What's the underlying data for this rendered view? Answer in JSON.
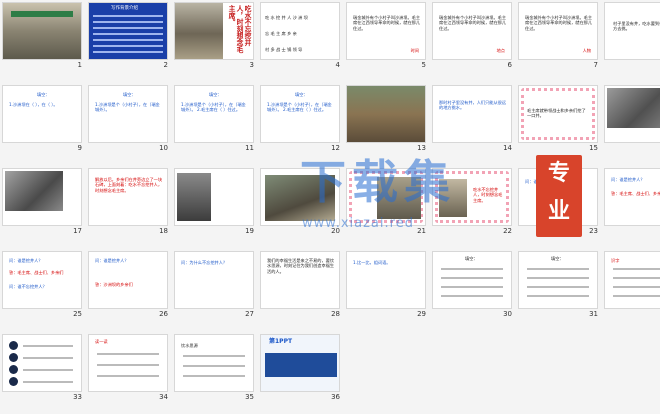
{
  "slides": [
    {
      "n": "1"
    },
    {
      "n": "2"
    },
    {
      "n": "3"
    },
    {
      "n": "4"
    },
    {
      "n": "5"
    },
    {
      "n": "6"
    },
    {
      "n": "7"
    },
    {
      "n": "8"
    },
    {
      "n": "9"
    },
    {
      "n": "10"
    },
    {
      "n": "11"
    },
    {
      "n": "12"
    },
    {
      "n": "13"
    },
    {
      "n": "14"
    },
    {
      "n": "15"
    },
    {
      "n": "16"
    },
    {
      "n": "17"
    },
    {
      "n": "18"
    },
    {
      "n": "19"
    },
    {
      "n": "20"
    },
    {
      "n": "21"
    },
    {
      "n": "22"
    },
    {
      "n": "23"
    },
    {
      "n": "24"
    },
    {
      "n": "25"
    },
    {
      "n": "26"
    },
    {
      "n": "27"
    },
    {
      "n": "28"
    },
    {
      "n": "29"
    },
    {
      "n": "30"
    },
    {
      "n": "31"
    },
    {
      "n": "32"
    },
    {
      "n": "33"
    },
    {
      "n": "34"
    },
    {
      "n": "35"
    },
    {
      "n": "36"
    }
  ],
  "text": {
    "s2_title": "写作背景介绍",
    "s3_vert": "吃水不忘挖井人，时刻想念毛主席。",
    "s4_l1": "吃  水  挖  井  人  沙  洲  坝",
    "s4_l2": "忘  毛  主  席  乡  亲",
    "s4_l3": "村  多  战  士  锅  领  导",
    "s5_text": "瑞金城外有个小村子叫沙洲坝。毛主席在江西领导革命的时候，就在那儿住过。",
    "s5_tag": "时间",
    "s6_tag": "地点",
    "s7_tag": "人物",
    "s9_title": "填空：",
    "s9_q": "1.沙洲坝在（  ），在（  ）。",
    "s10_title": "填空：",
    "s10_q": "1.沙洲坝是个（小村子），在（瑞金城外）。",
    "s11_title": "填空：",
    "s11_q": "1.沙洲坝是个（小村子），在（瑞金城外）。 2.毛主席在（  ）住过。",
    "s12_title": "填空：",
    "s12_q": "1.沙洲坝是个（小村子），在（瑞金城外）。 2.毛主席在（  ）住过。",
    "s14_text": "那时村子里没有井，人们只能从很远的地方挑水。",
    "s8_text": "村子里没有井，吃水要到很远的地方去挑。",
    "s15_text": "毛主席就带领战士和乡亲们挖了一口井。",
    "s18_text": "解放以后，乡亲们在井旁边立了一块石碑，上面刻着：吃水不忘挖井人，时刻想念毛主席。",
    "s22_text": "吃水不忘挖井人，时刻想念毛主席。",
    "s23_q": "问：谁是挖井人？",
    "s24_q": "问：谁是挖井人？",
    "s24_a": "答：毛主席、战士们、乡亲们",
    "s25_q": "问：谁是挖井人？",
    "s25_a": "答：毛主席、战士们、乡亲们",
    "s25_q2": "问：谁不忘挖井人？",
    "s26_q": "问：谁是挖井人？",
    "s26_a2": "答：沙洲坝的乡亲们",
    "s27_text": "问：为什么不忘挖井人？",
    "s28_text": "我们的幸福生活是来之不易的，要饮水思源，时刻记住为我们创造幸福生活的人。",
    "s29_text": "1.比一比，组词语。",
    "s30_title": "填空：",
    "s31_title": "填空：",
    "s32_title": "识字",
    "s34_title": "读一读",
    "s35_l1": "饮水思源",
    "s36_title": "第1PPT",
    "wm_main": "下载集",
    "wm_url": "www.xiazai.red",
    "badge_top": "专",
    "badge_bot": "业"
  },
  "colors": {
    "accent_blue": "#1a56c8",
    "accent_red": "#d40000",
    "pink": "#f2a3b5",
    "watermark": "#286ed2"
  }
}
